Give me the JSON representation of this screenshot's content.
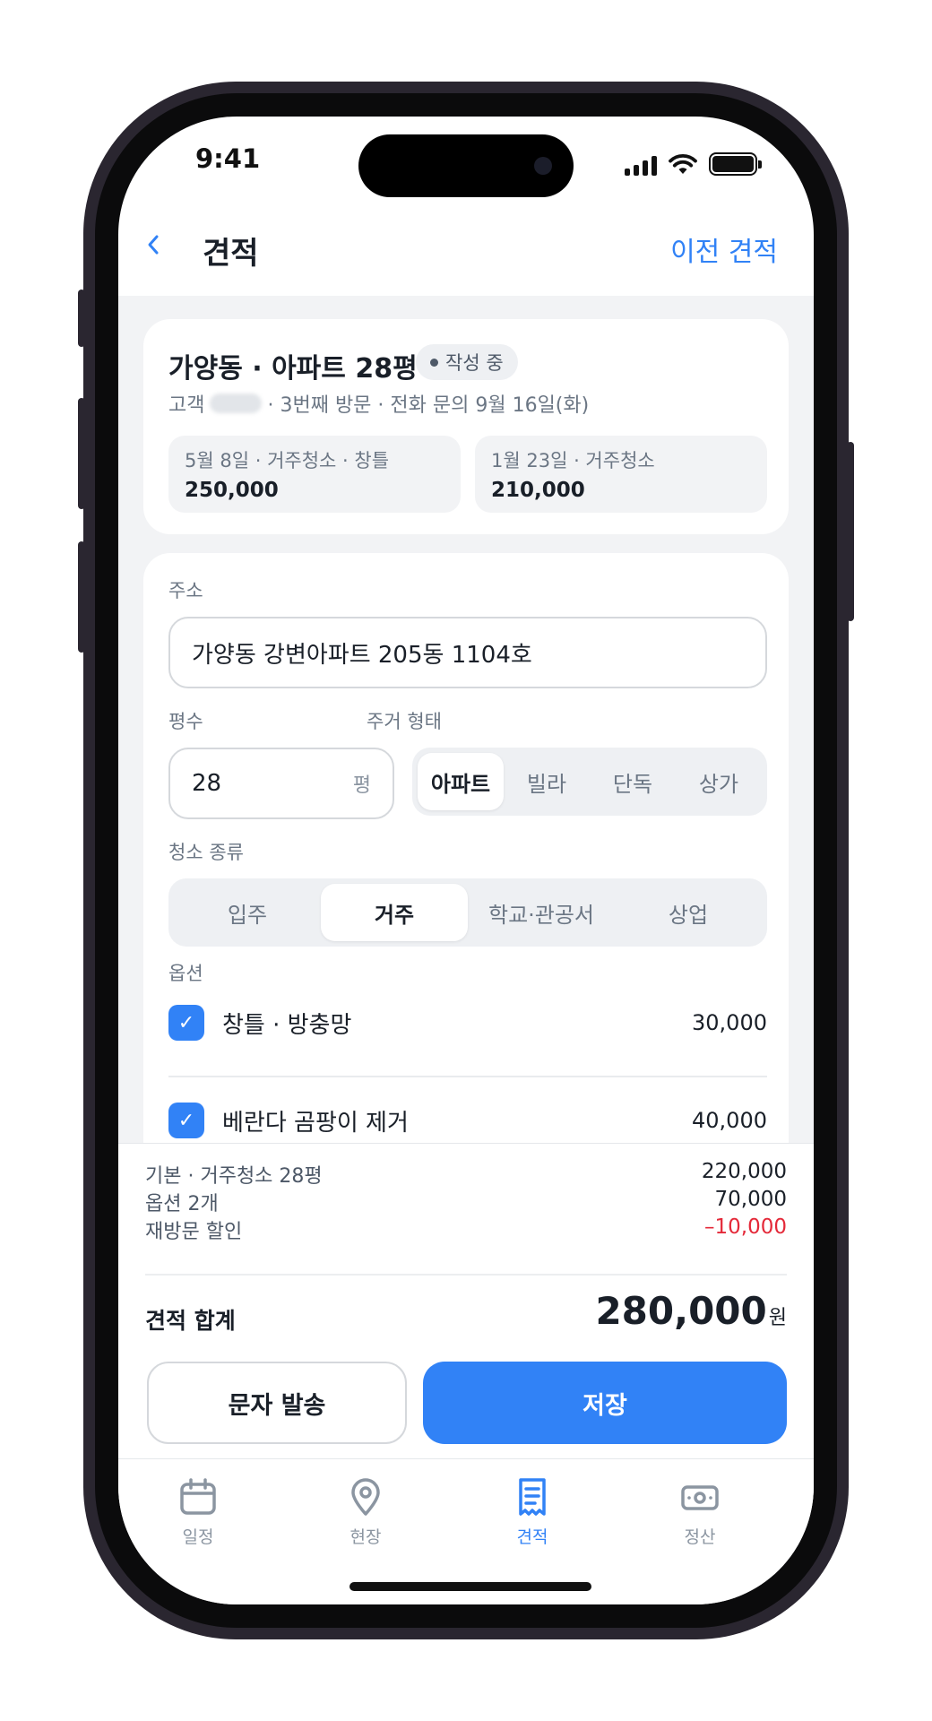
{
  "status_bar": {
    "time": "9:41"
  },
  "nav": {
    "back_icon": "chevron-left-icon",
    "title": "견적",
    "action": "이전 견적"
  },
  "job": {
    "title": "가양동 · 아파트 28평",
    "status": "작성 중",
    "meta_prefix": "고객",
    "meta_suffix": "· 3번째 방문 · 전화 문의 9월 16일(화)",
    "history": [
      {
        "label": "5월 8일 · 거주청소 · 창틀",
        "amount": "250,000"
      },
      {
        "label": "1월 23일 · 거주청소",
        "amount": "210,000"
      }
    ]
  },
  "form": {
    "address_label": "주소",
    "address_value": "가양동 강변아파트 205동 1104호",
    "pyeong_label": "평수",
    "pyeong_value": "28",
    "pyeong_unit": "평",
    "housing_label": "주거 형태",
    "housing_options": [
      "아파트",
      "빌라",
      "단독",
      "상가"
    ],
    "housing_selected": "아파트",
    "clean_label": "청소 종류",
    "clean_options": [
      "입주",
      "거주",
      "학교·관공서",
      "상업"
    ],
    "clean_selected": "거주",
    "options_label": "옵션",
    "options": [
      {
        "label": "창틀 · 방충망",
        "price": "30,000",
        "checked": true
      },
      {
        "label": "베란다 곰팡이 제거",
        "price": "40,000",
        "checked": true
      }
    ]
  },
  "summary": {
    "rows": [
      {
        "label": "기본 · 거주청소 28평",
        "value": "220,000"
      },
      {
        "label": "옵션 2개",
        "value": "70,000"
      },
      {
        "label": "재방문 할인",
        "value": "–10,000"
      }
    ],
    "total_label": "견적 합계",
    "total_value": "280,000",
    "total_unit": "원"
  },
  "actions": {
    "sms": "문자 발송",
    "save": "저장"
  },
  "tabs": [
    {
      "label": "일정",
      "icon": "calendar-icon"
    },
    {
      "label": "현장",
      "icon": "map-pin-icon"
    },
    {
      "label": "견적",
      "icon": "receipt-icon",
      "active": true
    },
    {
      "label": "정산",
      "icon": "cash-icon"
    }
  ],
  "colors": {
    "accent": "#3182f6",
    "negative": "#e42939",
    "background": "#f2f3f5"
  }
}
